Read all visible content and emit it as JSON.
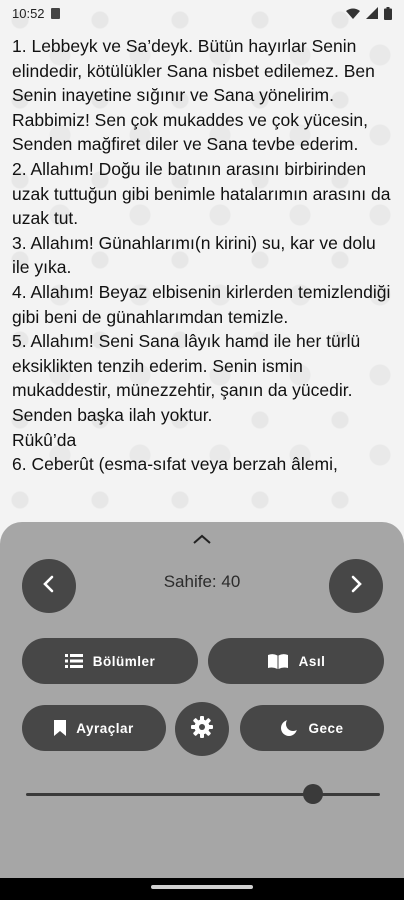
{
  "status": {
    "time": "10:52"
  },
  "content": {
    "paragraphs": [
      "1. Lebbeyk ve Sa’deyk. Bütün hayırlar Senin elindedir, kötülükler Sana nisbet edilemez. Ben Senin inayetine sığınır ve Sana yönelirim. Rabbimiz! Sen çok mukaddes ve çok yücesin, Senden mağfiret diler ve Sana tevbe ederim.",
      "2. Allahım! Doğu ile batının arasını birbirinden uzak tuttuğun gibi benimle hatalarımın arasını da uzak tut.",
      "3. Allahım! Günahlarımı(n kirini) su, kar ve dolu ile yıka.",
      "4. Allahım! Beyaz elbisenin kirlerden temizlendiği gibi beni de günahlarımdan temizle.",
      "5. Allahım! Seni Sana lâyık hamd ile her türlü eksiklikten tenzih ederim. Senin ismin mukaddestir, münezzehtir, şanın da yücedir. Senden başka ilah yoktur.",
      "Rükû’da",
      "6. Ceberût (esma-sıfat veya berzah âlemi,"
    ]
  },
  "controls": {
    "page_label": "Sahife: 40",
    "sections_label": "Bölümler",
    "original_label": "Asıl",
    "bookmarks_label": "Ayraçlar",
    "night_label": "Gece",
    "slider": {
      "value": 0.81
    }
  },
  "colors": {
    "panel_bg": "#a6a6a6",
    "button_bg": "#474747",
    "text": "#111111"
  },
  "icons": [
    "chevron-up-icon",
    "chevron-left-icon",
    "chevron-right-icon",
    "list-icon",
    "open-book-icon",
    "bookmark-icon",
    "gear-icon",
    "moon-icon"
  ]
}
